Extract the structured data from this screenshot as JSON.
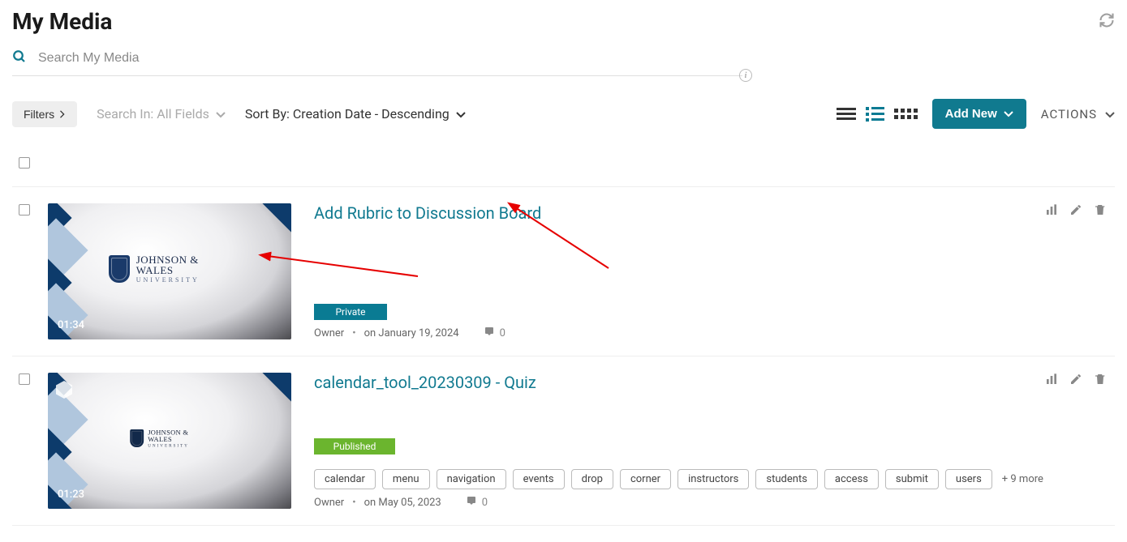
{
  "page_title": "My Media",
  "search": {
    "placeholder": "Search My Media"
  },
  "toolbar": {
    "filters_label": "Filters",
    "search_in_label": "Search In: All Fields",
    "sort_by_label": "Sort By: Creation Date - Descending",
    "add_new_label": "Add New",
    "actions_label": "ACTIONS"
  },
  "items": [
    {
      "title": "Add Rubric to Discussion Board",
      "duration": "01:34",
      "status_label": "Private",
      "status_class": "status-private",
      "owner_label": "Owner",
      "date_label": "on January 19, 2024",
      "comments": "0",
      "thumb_logo_main": "JOHNSON & WALES",
      "thumb_logo_sub": "UNIVERSITY",
      "tags": [],
      "more_tags": "",
      "has_quiz_badge": false
    },
    {
      "title": "calendar_tool_20230309 - Quiz",
      "duration": "01:23",
      "status_label": "Published",
      "status_class": "status-published",
      "owner_label": "Owner",
      "date_label": "on May 05, 2023",
      "comments": "0",
      "thumb_logo_main": "JOHNSON & WALES",
      "thumb_logo_sub": "UNIVERSITY",
      "tags": [
        "calendar",
        "menu",
        "navigation",
        "events",
        "drop",
        "corner",
        "instructors",
        "students",
        "access",
        "submit",
        "users"
      ],
      "more_tags": "+ 9 more",
      "has_quiz_badge": true
    }
  ]
}
